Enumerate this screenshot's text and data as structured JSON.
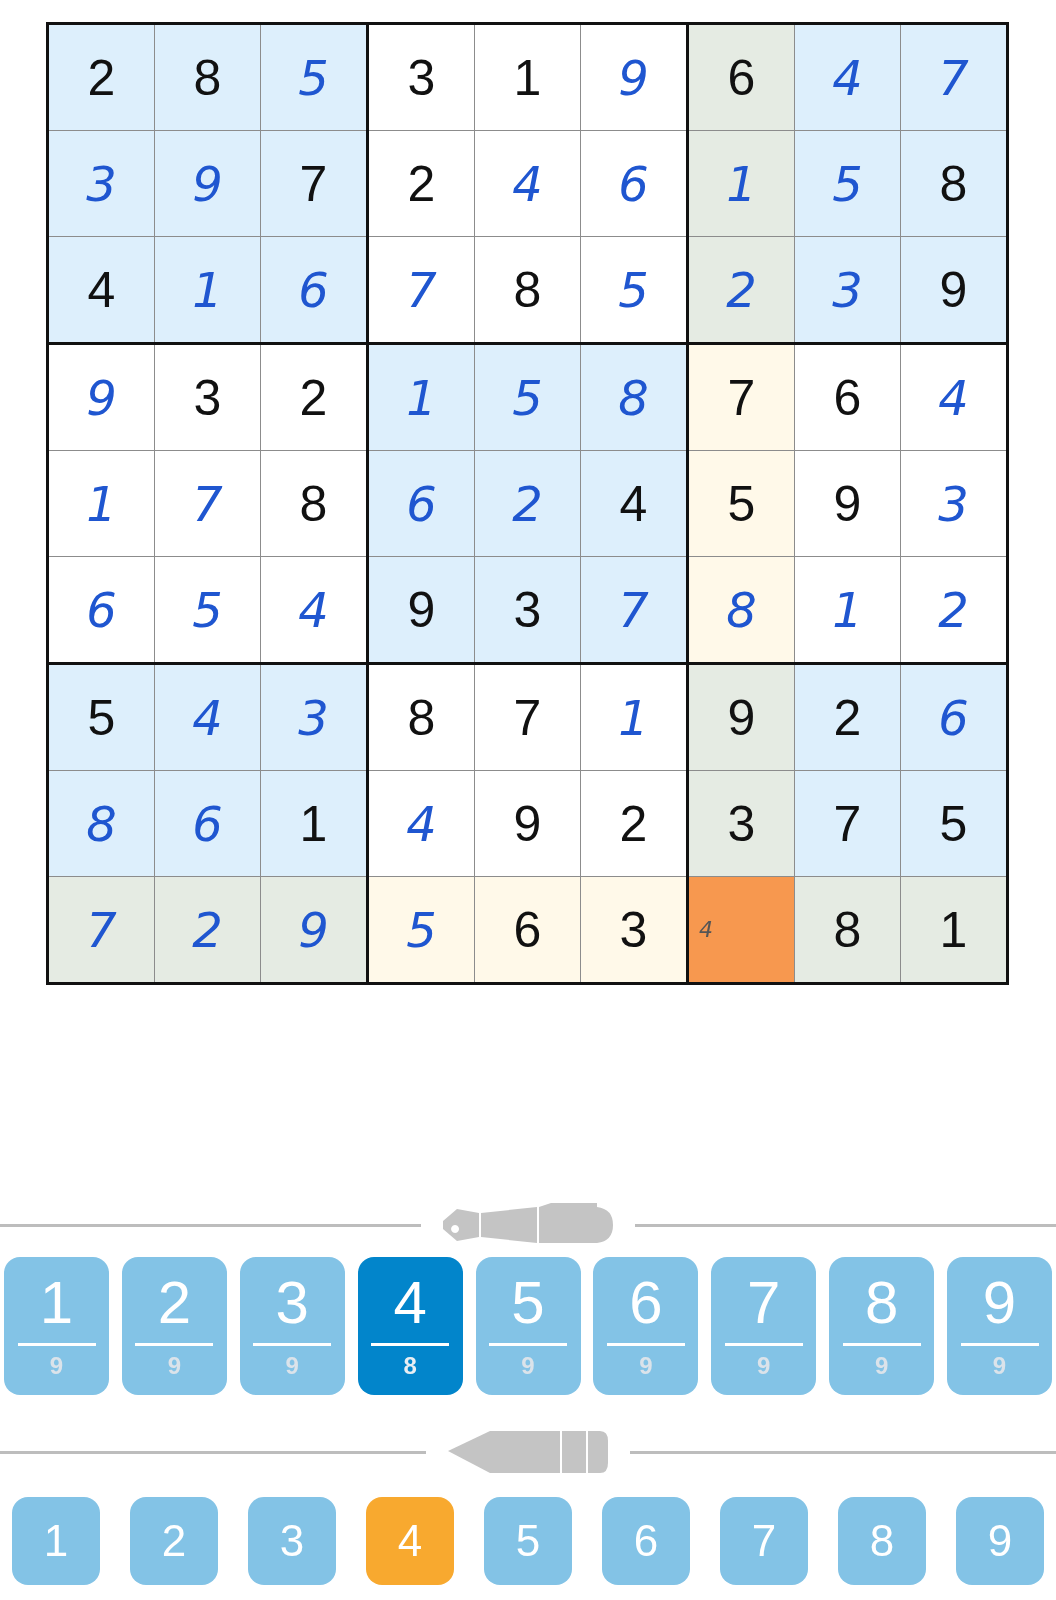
{
  "board": {
    "rows": [
      [
        {
          "value": "2",
          "given": true,
          "selected": false
        },
        {
          "value": "8",
          "given": true,
          "selected": false
        },
        {
          "value": "5",
          "given": false,
          "selected": false
        },
        {
          "value": "3",
          "given": true,
          "selected": false
        },
        {
          "value": "1",
          "given": true,
          "selected": false
        },
        {
          "value": "9",
          "given": false,
          "selected": false
        },
        {
          "value": "6",
          "given": true,
          "selected": false
        },
        {
          "value": "4",
          "given": false,
          "selected": false
        },
        {
          "value": "7",
          "given": false,
          "selected": false
        }
      ],
      [
        {
          "value": "3",
          "given": false,
          "selected": false
        },
        {
          "value": "9",
          "given": false,
          "selected": false
        },
        {
          "value": "7",
          "given": true,
          "selected": false
        },
        {
          "value": "2",
          "given": true,
          "selected": false
        },
        {
          "value": "4",
          "given": false,
          "selected": false
        },
        {
          "value": "6",
          "given": false,
          "selected": false
        },
        {
          "value": "1",
          "given": false,
          "selected": false
        },
        {
          "value": "5",
          "given": false,
          "selected": false
        },
        {
          "value": "8",
          "given": true,
          "selected": false
        }
      ],
      [
        {
          "value": "4",
          "given": true,
          "selected": false
        },
        {
          "value": "1",
          "given": false,
          "selected": false
        },
        {
          "value": "6",
          "given": false,
          "selected": false
        },
        {
          "value": "7",
          "given": false,
          "selected": false
        },
        {
          "value": "8",
          "given": true,
          "selected": false
        },
        {
          "value": "5",
          "given": false,
          "selected": false
        },
        {
          "value": "2",
          "given": false,
          "selected": false
        },
        {
          "value": "3",
          "given": false,
          "selected": false
        },
        {
          "value": "9",
          "given": true,
          "selected": false
        }
      ],
      [
        {
          "value": "9",
          "given": false,
          "selected": false
        },
        {
          "value": "3",
          "given": true,
          "selected": false
        },
        {
          "value": "2",
          "given": true,
          "selected": false
        },
        {
          "value": "1",
          "given": false,
          "selected": false
        },
        {
          "value": "5",
          "given": false,
          "selected": false
        },
        {
          "value": "8",
          "given": false,
          "selected": false
        },
        {
          "value": "7",
          "given": true,
          "selected": false
        },
        {
          "value": "6",
          "given": true,
          "selected": false
        },
        {
          "value": "4",
          "given": false,
          "selected": false
        }
      ],
      [
        {
          "value": "1",
          "given": false,
          "selected": false
        },
        {
          "value": "7",
          "given": false,
          "selected": false
        },
        {
          "value": "8",
          "given": true,
          "selected": false
        },
        {
          "value": "6",
          "given": false,
          "selected": false
        },
        {
          "value": "2",
          "given": false,
          "selected": false
        },
        {
          "value": "4",
          "given": true,
          "selected": false
        },
        {
          "value": "5",
          "given": true,
          "selected": false
        },
        {
          "value": "9",
          "given": true,
          "selected": false
        },
        {
          "value": "3",
          "given": false,
          "selected": false
        }
      ],
      [
        {
          "value": "6",
          "given": false,
          "selected": false
        },
        {
          "value": "5",
          "given": false,
          "selected": false
        },
        {
          "value": "4",
          "given": false,
          "selected": false
        },
        {
          "value": "9",
          "given": true,
          "selected": false
        },
        {
          "value": "3",
          "given": true,
          "selected": false
        },
        {
          "value": "7",
          "given": false,
          "selected": false
        },
        {
          "value": "8",
          "given": false,
          "selected": false
        },
        {
          "value": "1",
          "given": false,
          "selected": false
        },
        {
          "value": "2",
          "given": false,
          "selected": false
        }
      ],
      [
        {
          "value": "5",
          "given": true,
          "selected": false
        },
        {
          "value": "4",
          "given": false,
          "selected": false
        },
        {
          "value": "3",
          "given": false,
          "selected": false
        },
        {
          "value": "8",
          "given": true,
          "selected": false
        },
        {
          "value": "7",
          "given": true,
          "selected": false
        },
        {
          "value": "1",
          "given": false,
          "selected": false
        },
        {
          "value": "9",
          "given": true,
          "selected": false
        },
        {
          "value": "2",
          "given": true,
          "selected": false
        },
        {
          "value": "6",
          "given": false,
          "selected": false
        }
      ],
      [
        {
          "value": "8",
          "given": false,
          "selected": false
        },
        {
          "value": "6",
          "given": false,
          "selected": false
        },
        {
          "value": "1",
          "given": true,
          "selected": false
        },
        {
          "value": "4",
          "given": false,
          "selected": false
        },
        {
          "value": "9",
          "given": true,
          "selected": false
        },
        {
          "value": "2",
          "given": true,
          "selected": false
        },
        {
          "value": "3",
          "given": true,
          "selected": false
        },
        {
          "value": "7",
          "given": true,
          "selected": false
        },
        {
          "value": "5",
          "given": true,
          "selected": false
        }
      ],
      [
        {
          "value": "7",
          "given": false,
          "selected": false
        },
        {
          "value": "2",
          "given": false,
          "selected": false
        },
        {
          "value": "9",
          "given": false,
          "selected": false
        },
        {
          "value": "5",
          "given": false,
          "selected": false
        },
        {
          "value": "6",
          "given": true,
          "selected": false
        },
        {
          "value": "3",
          "given": true,
          "selected": false
        },
        {
          "note": "4",
          "given": false,
          "selected": true
        },
        {
          "value": "8",
          "given": true,
          "selected": false
        },
        {
          "value": "1",
          "given": true,
          "selected": false
        }
      ]
    ]
  },
  "pen_keys": [
    {
      "digit": "1",
      "count": "9",
      "selected": false
    },
    {
      "digit": "2",
      "count": "9",
      "selected": false
    },
    {
      "digit": "3",
      "count": "9",
      "selected": false
    },
    {
      "digit": "4",
      "count": "8",
      "selected": true
    },
    {
      "digit": "5",
      "count": "9",
      "selected": false
    },
    {
      "digit": "6",
      "count": "9",
      "selected": false
    },
    {
      "digit": "7",
      "count": "9",
      "selected": false
    },
    {
      "digit": "8",
      "count": "9",
      "selected": false
    },
    {
      "digit": "9",
      "count": "9",
      "selected": false
    }
  ],
  "pencil_keys": [
    {
      "digit": "1",
      "selected": false
    },
    {
      "digit": "2",
      "selected": false
    },
    {
      "digit": "3",
      "selected": false
    },
    {
      "digit": "4",
      "selected": true
    },
    {
      "digit": "5",
      "selected": false
    },
    {
      "digit": "6",
      "selected": false
    },
    {
      "digit": "7",
      "selected": false
    },
    {
      "digit": "8",
      "selected": false
    },
    {
      "digit": "9",
      "selected": false
    }
  ]
}
